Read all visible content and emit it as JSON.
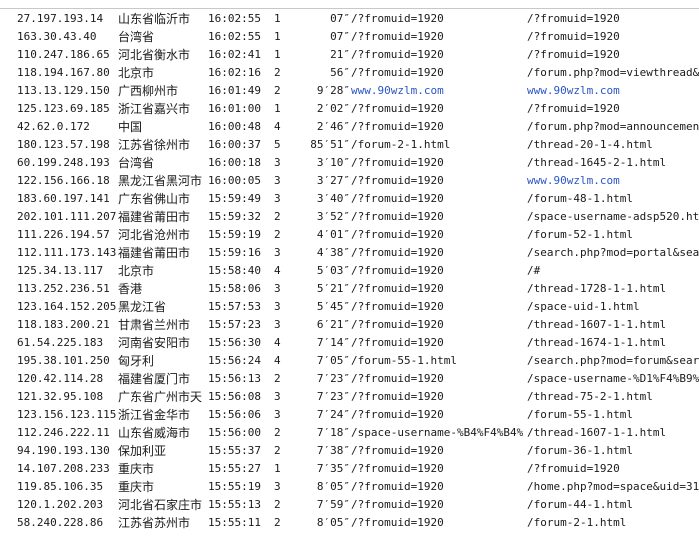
{
  "rows": [
    {
      "ip": "27.197.193.14",
      "location": "山东省临沂市",
      "time": "16:02:55",
      "count": "1",
      "duration": "07″",
      "from": "/?fromuid=1920",
      "page": "/?fromuid=1920",
      "from_link": false,
      "page_link": false
    },
    {
      "ip": "163.30.43.40",
      "location": "台湾省",
      "time": "16:02:55",
      "count": "1",
      "duration": "07″",
      "from": "/?fromuid=1920",
      "page": "/?fromuid=1920",
      "from_link": false,
      "page_link": false
    },
    {
      "ip": "110.247.186.65",
      "location": "河北省衡水市",
      "time": "16:02:41",
      "count": "1",
      "duration": "21″",
      "from": "/?fromuid=1920",
      "page": "/?fromuid=1920",
      "from_link": false,
      "page_link": false
    },
    {
      "ip": "118.194.167.80",
      "location": "北京市",
      "time": "16:02:16",
      "count": "2",
      "duration": "56″",
      "from": "/?fromuid=1920",
      "page": "/forum.php?mod=viewthread&ti",
      "from_link": false,
      "page_link": false
    },
    {
      "ip": "113.13.129.150",
      "location": "广西柳州市",
      "time": "16:01:49",
      "count": "2",
      "duration": "9′28″",
      "from": "www.90wzlm.com",
      "page": "www.90wzlm.com",
      "from_link": true,
      "page_link": true
    },
    {
      "ip": "125.123.69.185",
      "location": "浙江省嘉兴市",
      "time": "16:01:00",
      "count": "1",
      "duration": "2′02″",
      "from": "/?fromuid=1920",
      "page": "/?fromuid=1920",
      "from_link": false,
      "page_link": false
    },
    {
      "ip": "42.62.0.172",
      "location": "中国",
      "time": "16:00:48",
      "count": "4",
      "duration": "2′46″",
      "from": "/?fromuid=1920",
      "page": "/forum.php?mod=announcement&",
      "from_link": false,
      "page_link": false
    },
    {
      "ip": "180.123.57.198",
      "location": "江苏省徐州市",
      "time": "16:00:37",
      "count": "5",
      "duration": "85′51″",
      "from": "/forum-2-1.html",
      "page": "/thread-20-1-4.html",
      "from_link": false,
      "page_link": false
    },
    {
      "ip": "60.199.248.193",
      "location": "台湾省",
      "time": "16:00:18",
      "count": "3",
      "duration": "3′10″",
      "from": "/?fromuid=1920",
      "page": "/thread-1645-2-1.html",
      "from_link": false,
      "page_link": false
    },
    {
      "ip": "122.156.166.18",
      "location": "黑龙江省黑河市",
      "time": "16:00:05",
      "count": "3",
      "duration": "3′27″",
      "from": "/?fromuid=1920",
      "page": "www.90wzlm.com",
      "from_link": false,
      "page_link": true
    },
    {
      "ip": "183.60.197.141",
      "location": "广东省佛山市",
      "time": "15:59:49",
      "count": "3",
      "duration": "3′40″",
      "from": "/?fromuid=1920",
      "page": "/forum-48-1.html",
      "from_link": false,
      "page_link": false
    },
    {
      "ip": "202.101.111.207",
      "location": "福建省莆田市",
      "time": "15:59:32",
      "count": "2",
      "duration": "3′52″",
      "from": "/?fromuid=1920",
      "page": "/space-username-adsp520.html",
      "from_link": false,
      "page_link": false
    },
    {
      "ip": "111.226.194.57",
      "location": "河北省沧州市",
      "time": "15:59:19",
      "count": "2",
      "duration": "4′01″",
      "from": "/?fromuid=1920",
      "page": "/forum-52-1.html",
      "from_link": false,
      "page_link": false
    },
    {
      "ip": "112.111.173.143",
      "location": "福建省莆田市",
      "time": "15:59:16",
      "count": "3",
      "duration": "4′38″",
      "from": "/?fromuid=1920",
      "page": "/search.php?mod=portal&searc",
      "from_link": false,
      "page_link": false
    },
    {
      "ip": "125.34.13.117",
      "location": "北京市",
      "time": "15:58:40",
      "count": "4",
      "duration": "5′03″",
      "from": "/?fromuid=1920",
      "page": "/#",
      "from_link": false,
      "page_link": false
    },
    {
      "ip": "113.252.236.51",
      "location": "香港",
      "time": "15:58:06",
      "count": "3",
      "duration": "5′21″",
      "from": "/?fromuid=1920",
      "page": "/thread-1728-1-1.html",
      "from_link": false,
      "page_link": false
    },
    {
      "ip": "123.164.152.205",
      "location": "黑龙江省",
      "time": "15:57:53",
      "count": "3",
      "duration": "5′45″",
      "from": "/?fromuid=1920",
      "page": "/space-uid-1.html",
      "from_link": false,
      "page_link": false
    },
    {
      "ip": "118.183.200.21",
      "location": "甘肃省兰州市",
      "time": "15:57:23",
      "count": "3",
      "duration": "6′21″",
      "from": "/?fromuid=1920",
      "page": "/thread-1607-1-1.html",
      "from_link": false,
      "page_link": false
    },
    {
      "ip": "61.54.225.183",
      "location": "河南省安阳市",
      "time": "15:56:30",
      "count": "4",
      "duration": "7′14″",
      "from": "/?fromuid=1920",
      "page": "/thread-1674-1-1.html",
      "from_link": false,
      "page_link": false
    },
    {
      "ip": "195.38.101.250",
      "location": "匈牙利",
      "time": "15:56:24",
      "count": "4",
      "duration": "7′05″",
      "from": "/forum-55-1.html",
      "page": "/search.php?mod=forum&search",
      "from_link": false,
      "page_link": false
    },
    {
      "ip": "120.42.114.28",
      "location": "福建省厦门市",
      "time": "15:56:13",
      "count": "2",
      "duration": "7′23″",
      "from": "/?fromuid=1920",
      "page": "/space-username-%D1%F4%B9%E2",
      "from_link": false,
      "page_link": false
    },
    {
      "ip": "121.32.95.108",
      "location": "广东省广州市天",
      "time": "15:56:08",
      "count": "3",
      "duration": "7′23″",
      "from": "/?fromuid=1920",
      "page": "/thread-75-2-1.html",
      "from_link": false,
      "page_link": false
    },
    {
      "ip": "123.156.123.115",
      "location": "浙江省金华市",
      "time": "15:56:06",
      "count": "3",
      "duration": "7′24″",
      "from": "/?fromuid=1920",
      "page": "/forum-55-1.html",
      "from_link": false,
      "page_link": false
    },
    {
      "ip": "112.246.222.11",
      "location": "山东省威海市",
      "time": "15:56:00",
      "count": "2",
      "duration": "7′18″",
      "from": "/space-username-%B4%F4%B4%F4",
      "page": "/thread-1607-1-1.html",
      "from_link": false,
      "page_link": false
    },
    {
      "ip": "94.190.193.130",
      "location": "保加利亚",
      "time": "15:55:37",
      "count": "2",
      "duration": "7′38″",
      "from": "/?fromuid=1920",
      "page": "/forum-36-1.html",
      "from_link": false,
      "page_link": false
    },
    {
      "ip": "14.107.208.233",
      "location": "重庆市",
      "time": "15:55:27",
      "count": "1",
      "duration": "7′35″",
      "from": "/?fromuid=1920",
      "page": "/?fromuid=1920",
      "from_link": false,
      "page_link": false
    },
    {
      "ip": "119.85.106.35",
      "location": "重庆市",
      "time": "15:55:19",
      "count": "3",
      "duration": "8′05″",
      "from": "/?fromuid=1920",
      "page": "/home.php?mod=space&uid=319&",
      "from_link": false,
      "page_link": false
    },
    {
      "ip": "120.1.202.203",
      "location": "河北省石家庄市",
      "time": "15:55:13",
      "count": "2",
      "duration": "7′59″",
      "from": "/?fromuid=1920",
      "page": "/forum-44-1.html",
      "from_link": false,
      "page_link": false
    },
    {
      "ip": "58.240.228.86",
      "location": "江苏省苏州市",
      "time": "15:55:11",
      "count": "2",
      "duration": "8′05″",
      "from": "/?fromuid=1920",
      "page": "/forum-2-1.html",
      "from_link": false,
      "page_link": false
    }
  ]
}
